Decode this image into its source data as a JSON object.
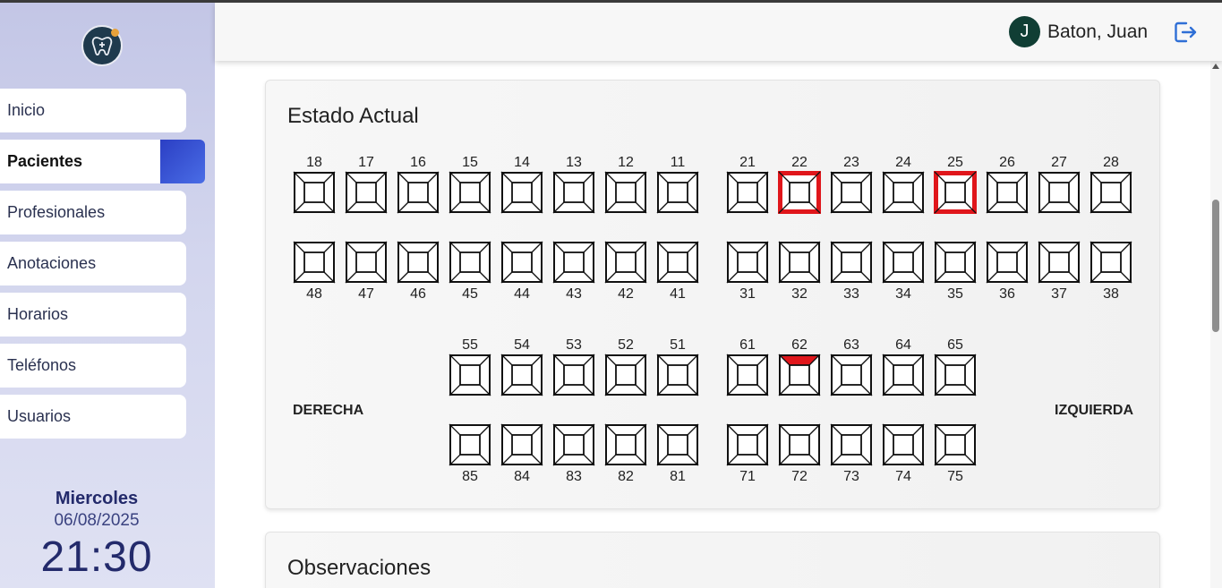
{
  "sidebar": {
    "items": [
      {
        "label": "Inicio"
      },
      {
        "label": "Pacientes",
        "active": true
      },
      {
        "label": "Profesionales"
      },
      {
        "label": "Anotaciones"
      },
      {
        "label": "Horarios"
      },
      {
        "label": "Teléfonos"
      },
      {
        "label": "Usuarios"
      }
    ],
    "day": "Miercoles",
    "date": "06/08/2025",
    "time": "21:30"
  },
  "header": {
    "avatar_initial": "J",
    "username": "Baton, Juan",
    "logout_icon": "logout-icon"
  },
  "estado": {
    "title": "Estado Actual",
    "left_label": "DERECHA",
    "right_label": "IZQUIERDA",
    "rows": [
      {
        "teeth": [
          18,
          17,
          16,
          15,
          14,
          13,
          12,
          11,
          21,
          22,
          23,
          24,
          25,
          26,
          27,
          28
        ],
        "label_pos": "top"
      },
      {
        "teeth": [
          48,
          47,
          46,
          45,
          44,
          43,
          42,
          41,
          31,
          32,
          33,
          34,
          35,
          36,
          37,
          38
        ],
        "label_pos": "bottom"
      },
      {
        "teeth": [
          55,
          54,
          53,
          52,
          51,
          61,
          62,
          63,
          64,
          65
        ],
        "label_pos": "top"
      },
      {
        "teeth": [
          85,
          84,
          83,
          82,
          81,
          71,
          72,
          73,
          74,
          75
        ],
        "label_pos": "bottom"
      }
    ],
    "marked": {
      "22": "full",
      "25": "full",
      "62": "top"
    },
    "mark_color": "#e0161b"
  },
  "observaciones": {
    "title": "Observaciones"
  }
}
